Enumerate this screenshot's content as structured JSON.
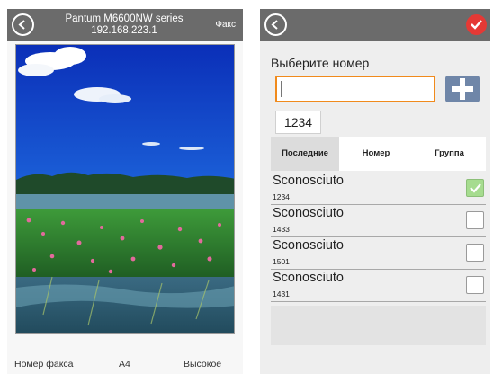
{
  "left_screen": {
    "title_line1": "Pantum M6600NW series",
    "title_line2": "192.168.223.1",
    "fax_label": "Факс",
    "bottom": {
      "fax_number_label": "Номер факса",
      "paper_size": "A4",
      "quality": "Высокое"
    }
  },
  "right_screen": {
    "prompt": "Выберите номер",
    "number_input": {
      "value": "",
      "placeholder": ""
    },
    "entered_number": "1234",
    "tabs": [
      {
        "label": "Последние",
        "active": true
      },
      {
        "label": "Номер",
        "active": false
      },
      {
        "label": "Группа",
        "active": false
      }
    ],
    "contacts": [
      {
        "name": "Sconosciuto",
        "number": "1234",
        "checked": true
      },
      {
        "name": "Sconosciuto",
        "number": "1433",
        "checked": false
      },
      {
        "name": "Sconosciuto",
        "number": "1501",
        "checked": false
      },
      {
        "name": "Sconosciuto",
        "number": "1431",
        "checked": false
      }
    ]
  },
  "icons": {
    "back": "back-arrow-icon",
    "confirm": "checkmark-icon",
    "add": "plus-icon",
    "checkbox_checked": "checkbox-checked-icon",
    "checkbox_empty": "checkbox-empty-icon"
  },
  "colors": {
    "topbar": "#6b6b6b",
    "input_border": "#f08a1c",
    "add_button": "#6f86a8",
    "confirm_button": "#e53935",
    "checkbox_checked": "#a6dc8f"
  }
}
